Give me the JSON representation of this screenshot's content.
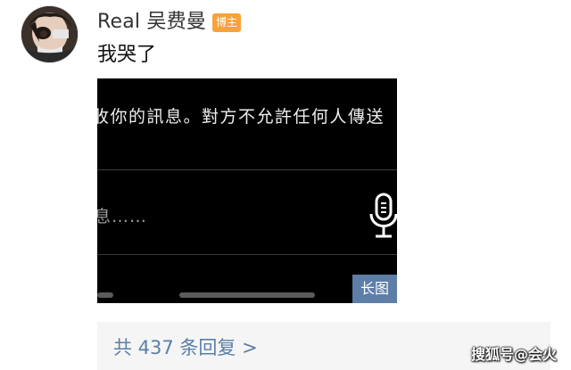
{
  "post": {
    "username": "Real 吴费曼",
    "badge": "博主",
    "text": "我哭了",
    "avatar_icon": "avatar-photo"
  },
  "screenshot": {
    "message_line": "收你的訊息。對方不允許任何人傳送",
    "input_placeholder": "息……",
    "mic_icon": "microphone-icon",
    "long_image_badge": "长图"
  },
  "replies": {
    "label": "共 437 条回复 >"
  },
  "watermark": {
    "text": "搜狐号@会火"
  },
  "colors": {
    "badge": "#f7a23a",
    "link": "#5b7fa6",
    "long_image_badge": "#5d7ea6",
    "reply_bar_bg": "#f5f5f5"
  }
}
